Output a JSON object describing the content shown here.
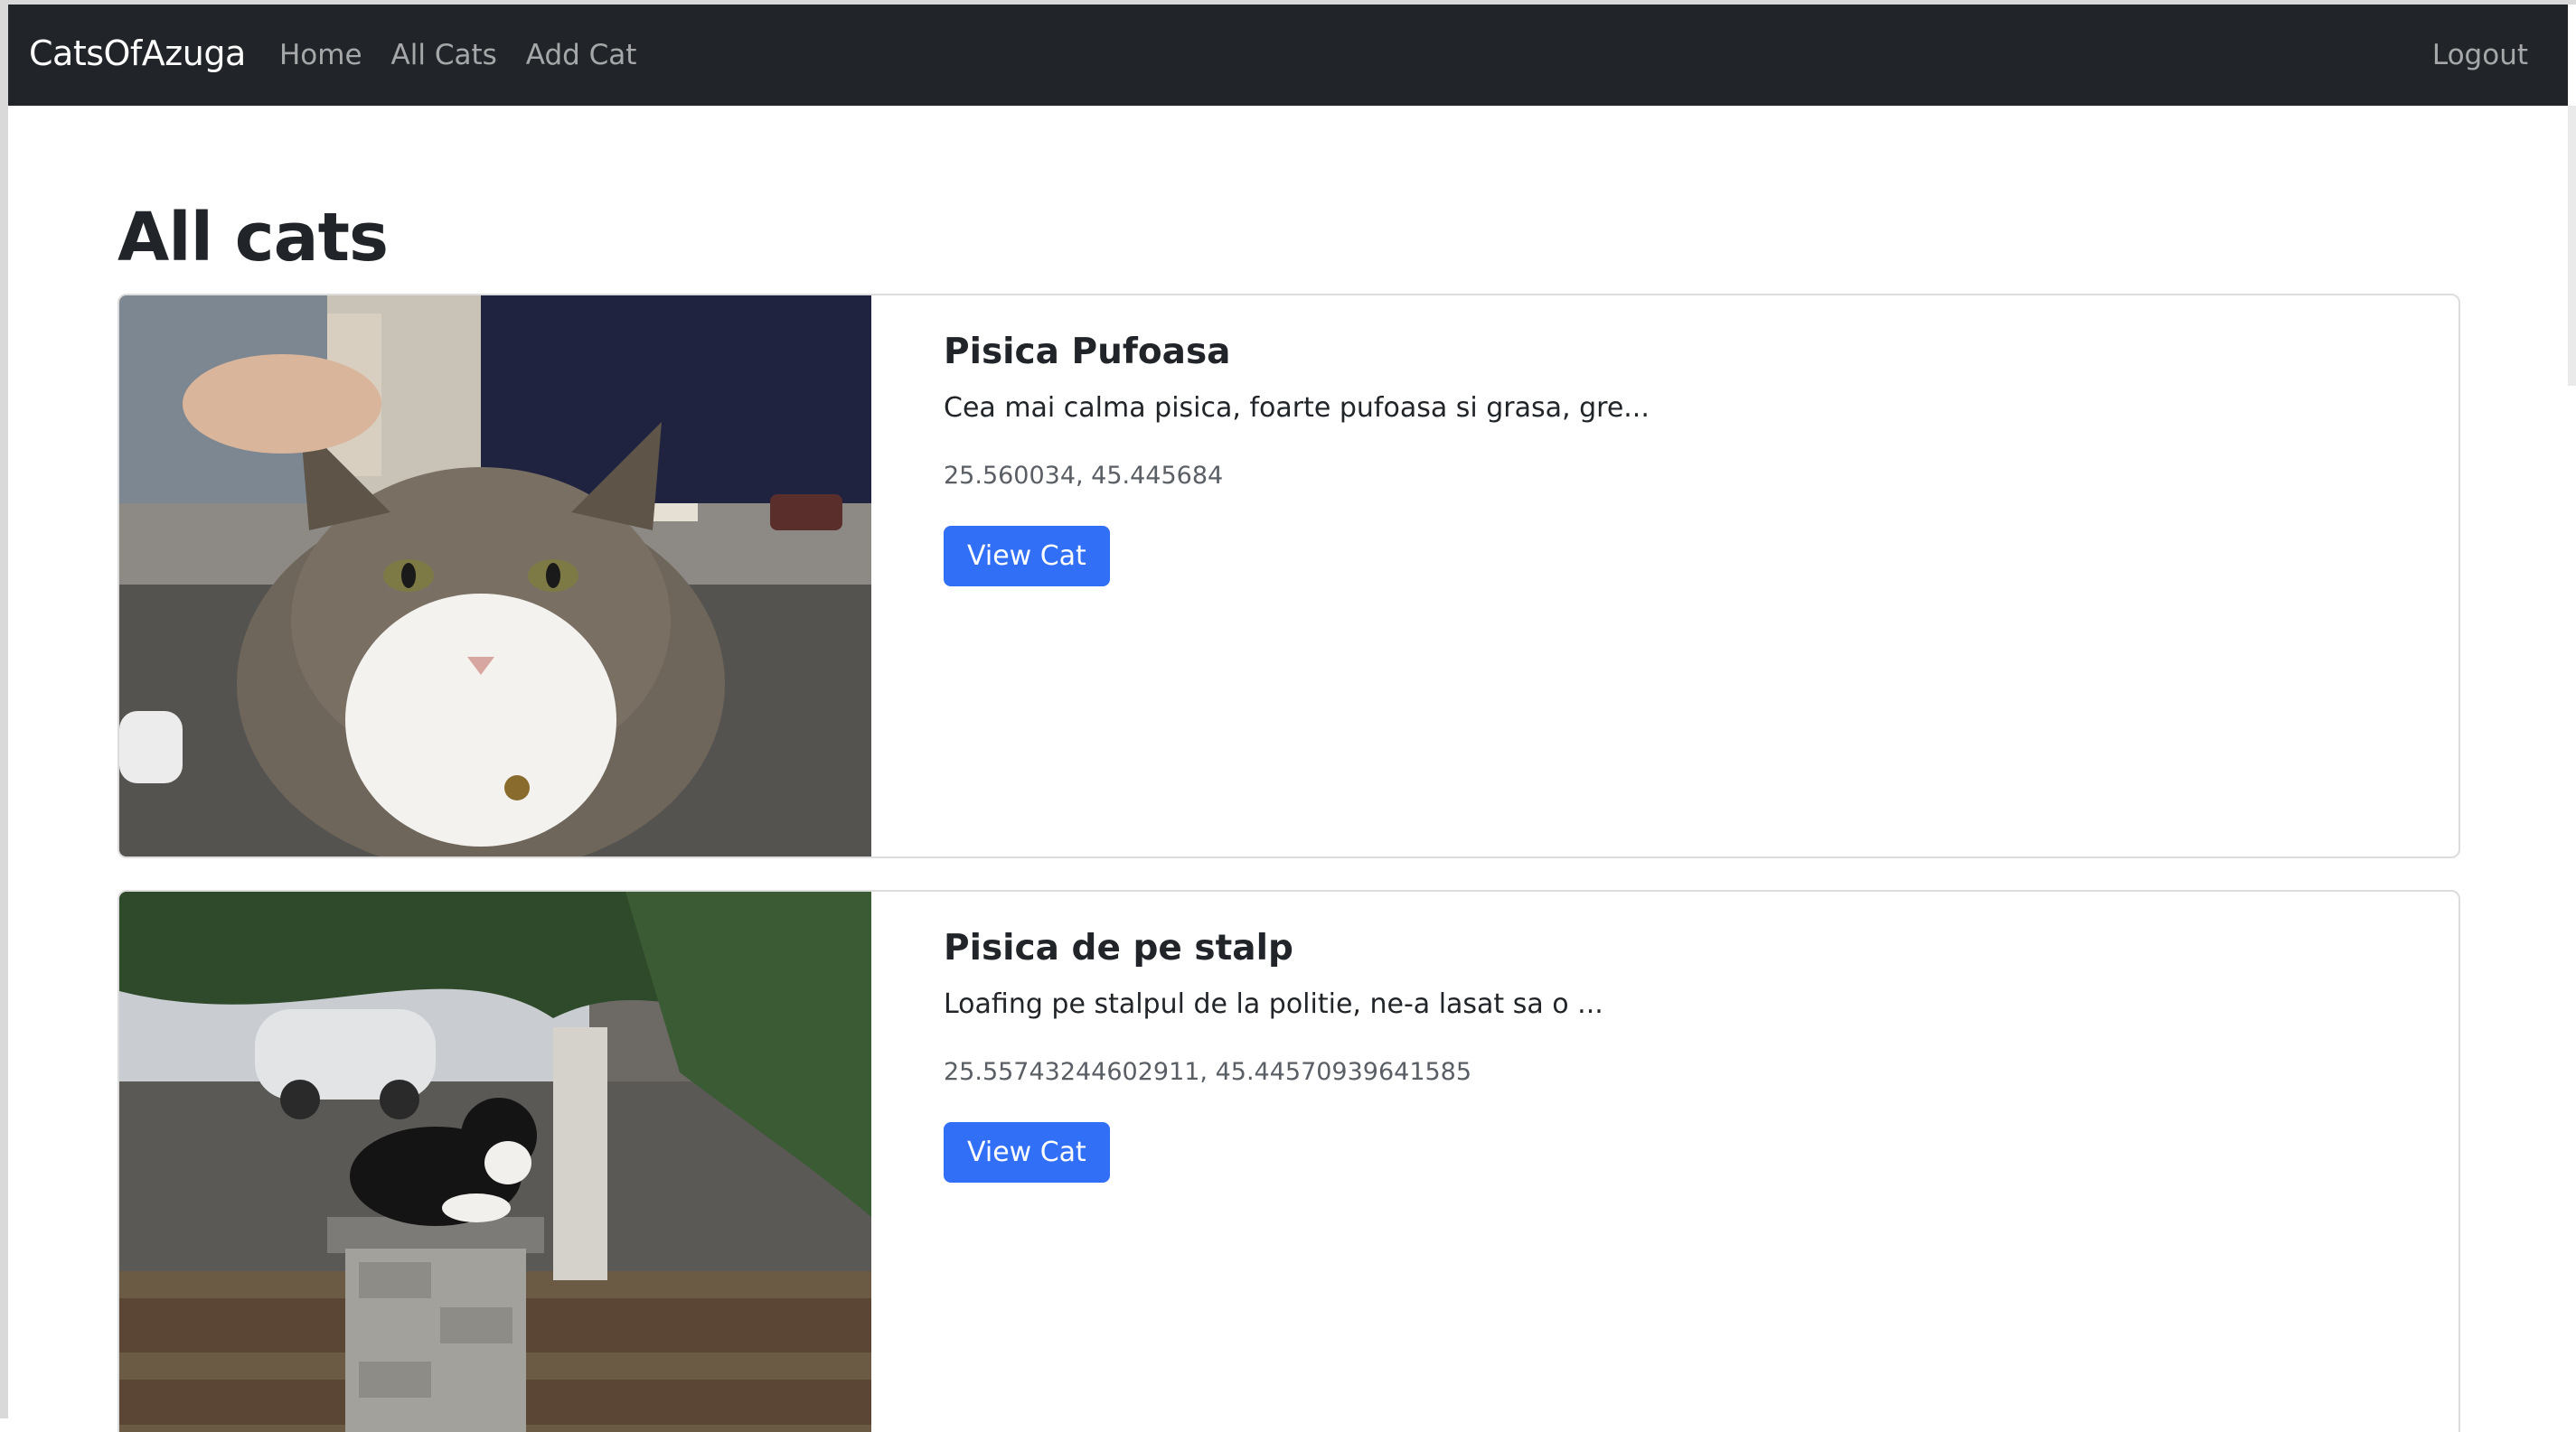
{
  "navbar": {
    "brand": "CatsOfAzuga",
    "links": [
      {
        "label": "Home"
      },
      {
        "label": "All Cats"
      },
      {
        "label": "Add Cat"
      }
    ],
    "logout_label": "Logout"
  },
  "main": {
    "title": "All cats",
    "cats": [
      {
        "name": "Pisica Pufoasa",
        "description": "Cea mai calma pisica, foarte pufoasa si grasa, gre...",
        "coordinates": "25.560034, 45.445684",
        "button_label": "View Cat",
        "image_icon": "fluffy-cat-photo"
      },
      {
        "name": "Pisica de pe stalp",
        "description": "Loafing pe stalpul de la politie, ne-a lasat sa o ...",
        "coordinates": "25.55743244602911, 45.44570939641585",
        "button_label": "View Cat",
        "image_icon": "cat-on-pillar-photo"
      }
    ]
  },
  "colors": {
    "navbar_bg": "#212529",
    "primary_button": "#316ff6",
    "text": "#212529",
    "muted": "#5a5f66"
  }
}
